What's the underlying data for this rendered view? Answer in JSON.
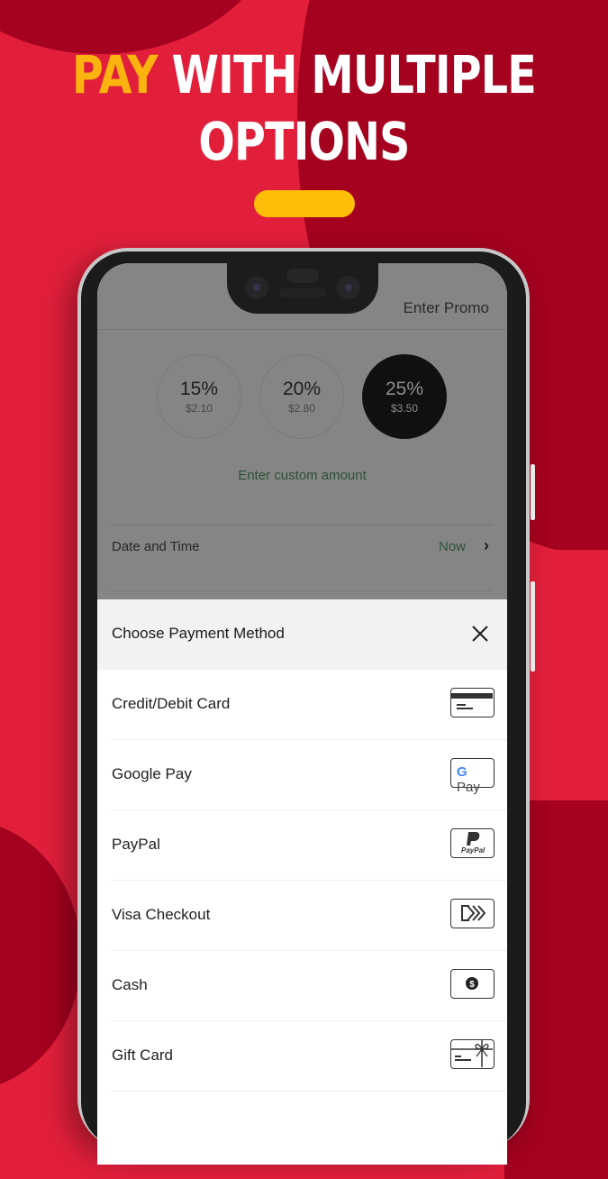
{
  "promo": {
    "headline_accent": "PAY",
    "headline_line1_rest": " WITH MULTIPLE",
    "headline_line2": "OPTIONS",
    "colors": {
      "background": "#e11f3b",
      "dark_shape": "#a4021f",
      "accent": "#fbb40f"
    }
  },
  "app": {
    "header": {
      "promo_link": "Enter Promo"
    },
    "tips": [
      {
        "percent": "15%",
        "amount": "$2.10",
        "selected": false
      },
      {
        "percent": "20%",
        "amount": "$2.80",
        "selected": false
      },
      {
        "percent": "25%",
        "amount": "$3.50",
        "selected": true
      }
    ],
    "custom_amount_link": "Enter custom amount",
    "date_time": {
      "label": "Date and Time",
      "value": "Now"
    },
    "payment_sheet": {
      "title": "Choose Payment Method",
      "methods": [
        {
          "label": "Credit/Debit Card",
          "icon": "credit-card-icon"
        },
        {
          "label": "Google Pay",
          "icon": "google-pay-icon",
          "icon_text": "Pay"
        },
        {
          "label": "PayPal",
          "icon": "paypal-icon",
          "icon_text": "PayPal"
        },
        {
          "label": "Visa Checkout",
          "icon": "visa-checkout-icon"
        },
        {
          "label": "Cash",
          "icon": "cash-icon"
        },
        {
          "label": "Gift Card",
          "icon": "gift-card-icon"
        }
      ]
    }
  }
}
